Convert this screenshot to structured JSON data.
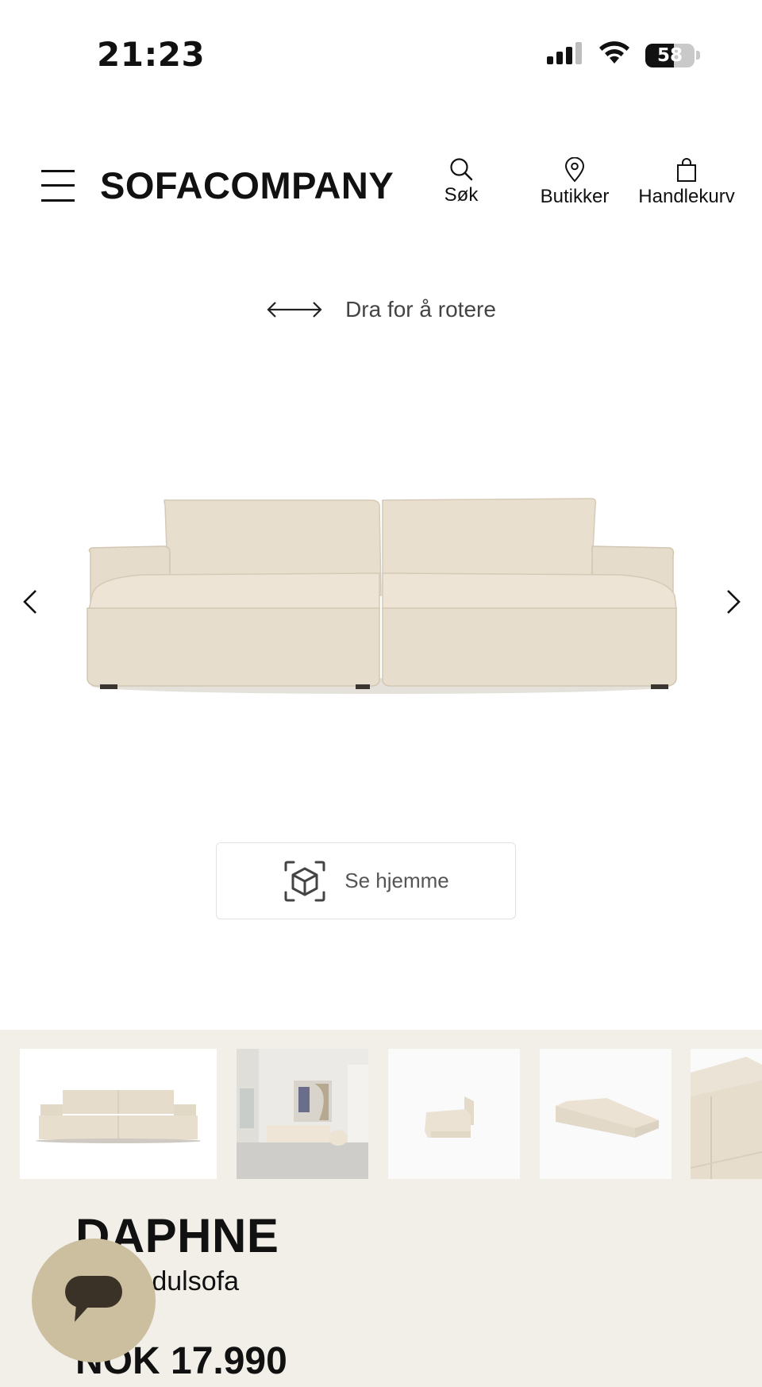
{
  "status_bar": {
    "time": "21:23",
    "battery_percent": "58",
    "battery_level": 0.58
  },
  "header": {
    "logo": "SOFACOMPANY",
    "nav": {
      "search_label": "Søk",
      "stores_label": "Butikker",
      "cart_label": "Handlekurv"
    }
  },
  "viewer": {
    "rotate_hint": "Dra for å rotere",
    "ar_button_label": "Se hjemme"
  },
  "product": {
    "name": "DAPHNE",
    "subtitle": "ter modulsofa",
    "price": "NOK 17.990"
  },
  "colors": {
    "band_background": "#f2efe9",
    "chat_button": "#cbbf9f",
    "sofa_fabric": "#e9dfcf"
  }
}
